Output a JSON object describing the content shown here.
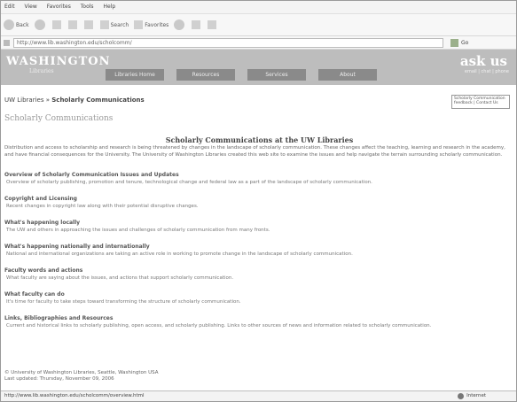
{
  "menu": [
    "Edit",
    "View",
    "Favorites",
    "Tools",
    "Help"
  ],
  "toolbar": {
    "back": "Back",
    "search": "Search",
    "favorites": "Favorites"
  },
  "address": {
    "url": "http://www.lib.washington.edu/scholcomm/",
    "go": "Go"
  },
  "header": {
    "logo": "WASHINGTON",
    "logo_sub": "Libraries",
    "nav": [
      "Libraries Home",
      "Resources",
      "Services",
      "About"
    ],
    "ask": "ask us",
    "ask_sub": "email | chat | phone"
  },
  "crumb": {
    "prefix": "UW Libraries » ",
    "current": "Scholarly Communications"
  },
  "feedback": "Scholarly Communication feedback | Contact Us",
  "page_title": "Scholarly Communications",
  "heading": "Scholarly Communications at the UW Libraries",
  "intro": "Distribution and access to scholarship and research is being threatened by changes in the landscape of scholarly communication. These changes affect the teaching, learning and research in the academy, and have financial consequences for the University. The University of Washington Libraries created this web site to examine the issues and help navigate the terrain surrounding scholarly communication.",
  "sections": [
    {
      "title": "Overview of Scholarly Communication Issues and Updates",
      "desc": "Overview of scholarly publishing, promotion and tenure, technological change and federal law as a part of the landscape of scholarly communication."
    },
    {
      "title": "Copyright and Licensing",
      "desc": "Recent changes in copyright law along with their potential disruptive changes."
    },
    {
      "title": "What's happening locally",
      "desc": "The UW and others in approaching the issues and challenges of scholarly communication from many fronts."
    },
    {
      "title": "What's happening nationally and internationally",
      "desc": "National and international organizations are taking an active role in working to promote change in the landscape of scholarly communication."
    },
    {
      "title": "Faculty words and actions",
      "desc": "What faculty are saying about the issues, and actions that support scholarly communication."
    },
    {
      "title": "What faculty can do",
      "desc": "It's time for faculty to take steps toward transforming the structure of scholarly communication."
    },
    {
      "title": "Links, Bibliographies and Resources",
      "desc": "Current and historical links to scholarly publishing, open access, and scholarly publishing. Links to other sources of news and information related to scholarly communication."
    }
  ],
  "footer": {
    "line1": "© University of Washington Libraries, Seattle, Washington USA",
    "line2": "Last updated: Thursday, November 09, 2006"
  },
  "status": {
    "url": "http://www.lib.washington.edu/scholcomm/overview.html",
    "zone": "Internet"
  }
}
